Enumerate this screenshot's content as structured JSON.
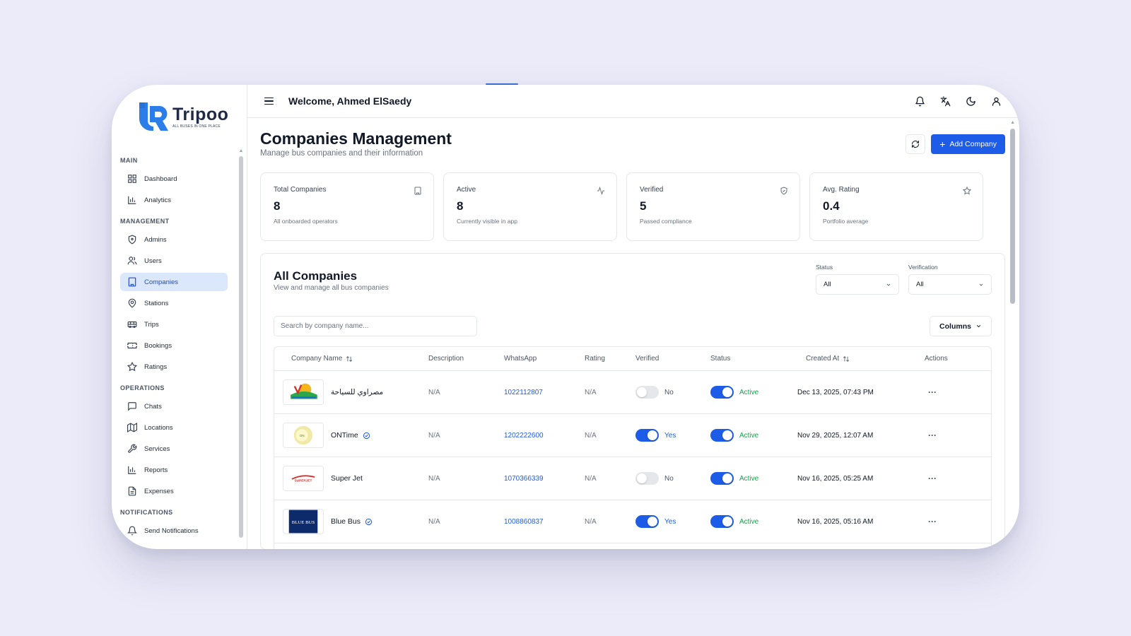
{
  "brand": {
    "name": "Tripoo",
    "tagline": "ALL BUSES IN ONE PLACE",
    "accent": "#1d5ce6"
  },
  "sidebar": {
    "sections": [
      {
        "title": "MAIN",
        "items": [
          {
            "label": "Dashboard",
            "icon": "grid-icon"
          },
          {
            "label": "Analytics",
            "icon": "bar-chart-icon"
          }
        ]
      },
      {
        "title": "MANAGEMENT",
        "items": [
          {
            "label": "Admins",
            "icon": "shield-icon"
          },
          {
            "label": "Users",
            "icon": "users-icon"
          },
          {
            "label": "Companies",
            "icon": "building-icon",
            "active": true
          },
          {
            "label": "Stations",
            "icon": "map-pin-icon"
          },
          {
            "label": "Trips",
            "icon": "bus-icon"
          },
          {
            "label": "Bookings",
            "icon": "ticket-icon"
          },
          {
            "label": "Ratings",
            "icon": "star-icon"
          }
        ]
      },
      {
        "title": "OPERATIONS",
        "items": [
          {
            "label": "Chats",
            "icon": "chat-icon"
          },
          {
            "label": "Locations",
            "icon": "map-icon"
          },
          {
            "label": "Services",
            "icon": "wrench-icon"
          },
          {
            "label": "Reports",
            "icon": "bar-chart-icon"
          },
          {
            "label": "Expenses",
            "icon": "file-icon"
          }
        ]
      },
      {
        "title": "NOTIFICATIONS",
        "items": [
          {
            "label": "Send Notifications",
            "icon": "bell-icon"
          }
        ]
      }
    ]
  },
  "header": {
    "welcome": "Welcome, Ahmed ElSaedy"
  },
  "page": {
    "title": "Companies Management",
    "subtitle": "Manage bus companies and their information",
    "add_label": "Add Company"
  },
  "stats": [
    {
      "label": "Total Companies",
      "value": "8",
      "desc": "All onboarded operators",
      "icon": "building-icon"
    },
    {
      "label": "Active",
      "value": "8",
      "desc": "Currently visible in app",
      "icon": "activity-icon"
    },
    {
      "label": "Verified",
      "value": "5",
      "desc": "Passed compliance",
      "icon": "shield-check-icon"
    },
    {
      "label": "Avg. Rating",
      "value": "0.4",
      "desc": "Portfolio average",
      "icon": "star-icon"
    }
  ],
  "panel": {
    "title": "All Companies",
    "subtitle": "View and manage all bus companies",
    "filters": {
      "status_label": "Status",
      "status_value": "All",
      "verification_label": "Verification",
      "verification_value": "All"
    },
    "search_placeholder": "Search by company name...",
    "columns_label": "Columns"
  },
  "table": {
    "headers": {
      "name": "Company Name",
      "description": "Description",
      "whatsapp": "WhatsApp",
      "rating": "Rating",
      "verified": "Verified",
      "status": "Status",
      "created": "Created At",
      "actions": "Actions"
    },
    "rows": [
      {
        "name": "مصراوي للسياحة",
        "logo": "masrawy-logo",
        "verified_badge": false,
        "description": "N/A",
        "whatsapp": "1022112807",
        "rating": "N/A",
        "verified": false,
        "verified_label": "No",
        "active": true,
        "status_label": "Active",
        "created": "Dec 13, 2025, 07:43 PM",
        "actions": "···"
      },
      {
        "name": "ONTime",
        "logo": "ontime-logo",
        "verified_badge": true,
        "description": "N/A",
        "whatsapp": "1202222600",
        "rating": "N/A",
        "verified": true,
        "verified_label": "Yes",
        "active": true,
        "status_label": "Active",
        "created": "Nov 29, 2025, 12:07 AM",
        "actions": "···"
      },
      {
        "name": "Super Jet",
        "logo": "superjet-logo",
        "verified_badge": false,
        "description": "N/A",
        "whatsapp": "1070366339",
        "rating": "N/A",
        "verified": false,
        "verified_label": "No",
        "active": true,
        "status_label": "Active",
        "created": "Nov 16, 2025, 05:25 AM",
        "actions": "···"
      },
      {
        "name": "Blue Bus",
        "logo": "bluebus-logo",
        "logo_text": "BLUE BUS",
        "verified_badge": true,
        "description": "N/A",
        "whatsapp": "1008860837",
        "rating": "N/A",
        "verified": true,
        "verified_label": "Yes",
        "active": true,
        "status_label": "Active",
        "created": "Nov 16, 2025, 05:16 AM",
        "actions": "···"
      }
    ]
  }
}
